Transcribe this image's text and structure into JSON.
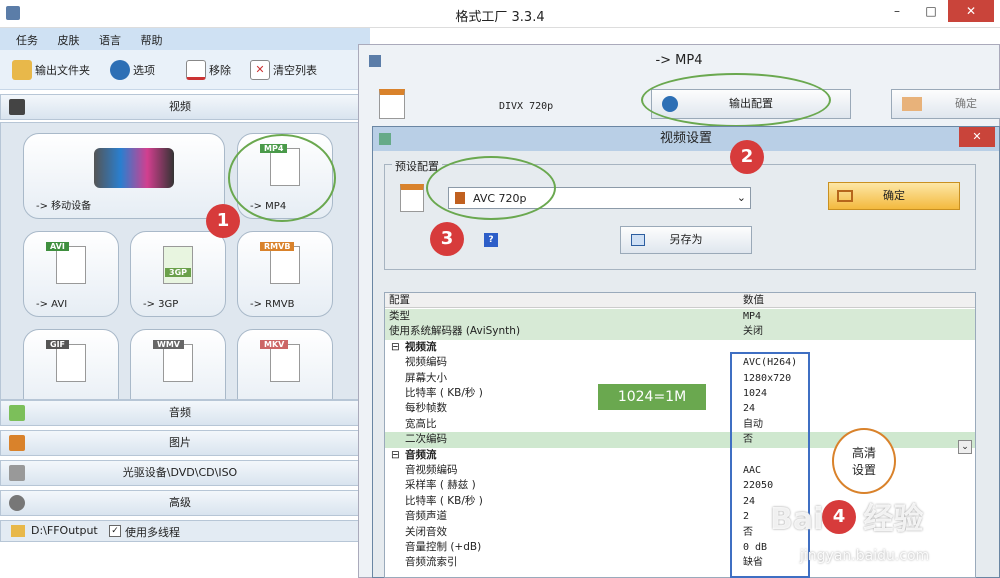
{
  "window": {
    "title": "格式工厂 3.3.4",
    "ctrl_min": "–",
    "ctrl_max": "□",
    "ctrl_close": "✕"
  },
  "menu": {
    "items": [
      "任务",
      "皮肤",
      "语言",
      "帮助"
    ]
  },
  "toolbar": {
    "output_folder": "输出文件夹",
    "options": "选项",
    "remove": "移除",
    "clear_list": "清空列表"
  },
  "categories": {
    "video": "视频",
    "audio": "音频",
    "image": "图片",
    "disc": "光驱设备\\DVD\\CD\\ISO",
    "advanced": "高级"
  },
  "formats": [
    {
      "label": "-> 移动设备",
      "tag": ""
    },
    {
      "label": "-> MP4",
      "tag": "MP4"
    },
    {
      "label": "-> AVI",
      "tag": "AVI"
    },
    {
      "label": "-> 3GP",
      "tag": "3GP"
    },
    {
      "label": "-> RMVB",
      "tag": "RMVB"
    },
    {
      "label": "",
      "tag": "GIF"
    },
    {
      "label": "",
      "tag": "WMV"
    },
    {
      "label": "",
      "tag": "MKV"
    }
  ],
  "status": {
    "path": "D:\\FFOutput",
    "multithread_label": "使用多线程"
  },
  "convert_dialog": {
    "title": "-> MP4",
    "preset_name": "DIVX 720p",
    "output_config": "输出配置",
    "ok": "确定"
  },
  "video_settings": {
    "title": "视频设置",
    "close": "✕",
    "preset_group": "预设配置",
    "preset_value": "AVC 720p",
    "ok": "确定",
    "save_as": "另存为",
    "help": "?",
    "columns": [
      "配置",
      "数值"
    ],
    "rows": [
      {
        "key": "类型",
        "value": "MP4",
        "level": 0
      },
      {
        "key": "使用系统解码器 (AviSynth)",
        "value": "关闭",
        "level": 0
      },
      {
        "key": "视频流",
        "value": "",
        "level": "section"
      },
      {
        "key": "视频编码",
        "value": "AVC(H264)",
        "level": 1
      },
      {
        "key": "屏幕大小",
        "value": "1280x720",
        "level": 1
      },
      {
        "key": "比特率 ( KB/秒 )",
        "value": "1024",
        "level": 1
      },
      {
        "key": "每秒帧数",
        "value": "24",
        "level": 1
      },
      {
        "key": "宽高比",
        "value": "自动",
        "level": 1
      },
      {
        "key": "二次编码",
        "value": "否",
        "level": 1
      },
      {
        "key": "音频流",
        "value": "",
        "level": "section"
      },
      {
        "key": "音视频编码",
        "value": "AAC",
        "level": 1
      },
      {
        "key": "采样率 ( 赫兹 )",
        "value": "22050",
        "level": 1
      },
      {
        "key": "比特率 ( KB/秒 )",
        "value": "24",
        "level": 1
      },
      {
        "key": "音频声道",
        "value": "2",
        "level": 1
      },
      {
        "key": "关闭音效",
        "value": "否",
        "level": 1
      },
      {
        "key": "音量控制 (+dB)",
        "value": "0 dB",
        "level": 1
      },
      {
        "key": "音频流索引",
        "value": "缺省",
        "level": 1
      }
    ]
  },
  "annotations": {
    "n1": "1",
    "n2": "2",
    "n3": "3",
    "n4": "4",
    "note_bitrate": "1024=1M",
    "note_hd_1": "高清",
    "note_hd_2": "设置"
  },
  "watermark": {
    "brand": "Bai",
    "brand2": "经验",
    "url": "jingyan.baidu.com"
  },
  "colors": {
    "annotation_green": "#6aa84f",
    "annotation_red": "#d73b3b",
    "highlight_blue": "#3f6fc3"
  }
}
